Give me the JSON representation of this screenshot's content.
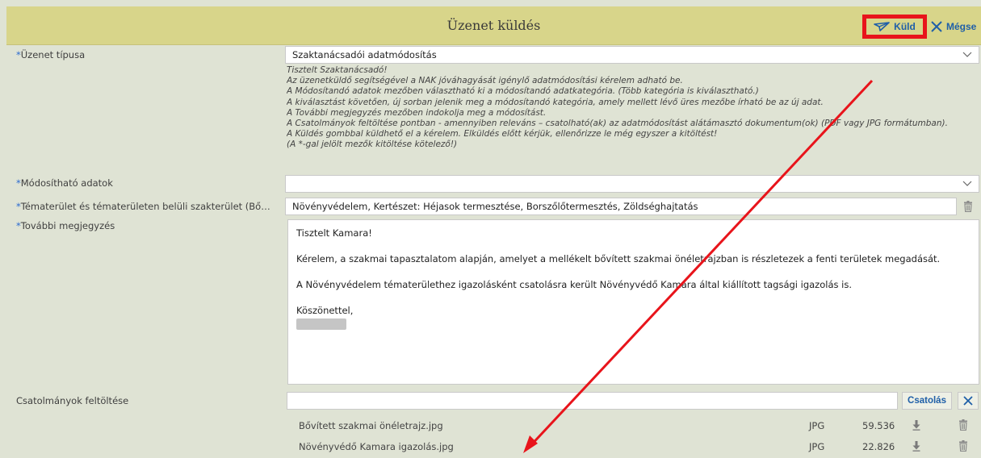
{
  "header": {
    "title": "Üzenet küldés",
    "send_label": "Küld",
    "cancel_label": "Mégse"
  },
  "form": {
    "message_type": {
      "label": "Üzenet típusa",
      "value": "Szaktanácsadói adatmódosítás"
    },
    "info_lines": [
      "Tisztelt Szaktanácsadó!",
      "Az üzenetküldő segítségével a NAK jóváhagyását igénylő adatmódosítási kérelem adható be.",
      "A Módosítandó adatok mezőben választható ki a módosítandó adatkategória. (Több kategória is kiválasztható.)",
      "A kiválasztást követően, új sorban jelenik meg a módosítandó kategória, amely mellett lévő üres mezőbe írható be az új adat.",
      "A További megjegyzés mezőben indokolja meg a módosítást.",
      "A Csatolmányok feltöltése pontban - amennyiben releváns – csatolható(ak) az adatmódosítást alátámasztó dokumentum(ok) (PDF vagy JPG formátumban).",
      "A Küldés gombbal küldhető el a kérelem. Elküldés előtt kérjük, ellenőrizze le még egyszer a kitöltést!",
      "(A *-gal jelölt mezők kitöltése kötelező!)"
    ],
    "modifiable": {
      "label": "Módosítható adatok",
      "value": ""
    },
    "topic_area": {
      "label": "Tématerület és tématerületen belüli szakterület (Bővít...",
      "value": "Növényvédelem, Kertészet: Héjasok termesztése, Borszőlőtermesztés, Zöldséghajtatás"
    },
    "notes": {
      "label": "További megjegyzés",
      "lines": [
        "Tisztelt Kamara!",
        "Kérelem, a szakmai tapasztalatom alapján, amelyet a mellékelt bővített szakmai önéletrajzban is részletezek a fenti területek megadását.",
        "A Növényvédelem tématerülethez igazolásként csatolásra került Növényvédő Kamara által kiállított tagsági igazolás is.",
        "Köszönettel,"
      ]
    },
    "attachments": {
      "label": "Csatolmányok feltöltése",
      "input_value": "",
      "attach_label": "Csatolás",
      "files": [
        {
          "name": "Bővített szakmai önéletrajz.jpg",
          "type": "JPG",
          "size": "59.536"
        },
        {
          "name": "Növényvédő Kamara igazolás.jpg",
          "type": "JPG",
          "size": "22.826"
        }
      ]
    },
    "required_mark": "*"
  },
  "colors": {
    "header_bg": "#d8d58a",
    "page_bg": "#dfe3d4",
    "accent_blue": "#1f5fa8",
    "highlight_red": "#e8141b"
  },
  "icons": [
    "paper-plane-icon",
    "close-icon",
    "chevron-down-icon",
    "trash-icon",
    "download-icon"
  ]
}
